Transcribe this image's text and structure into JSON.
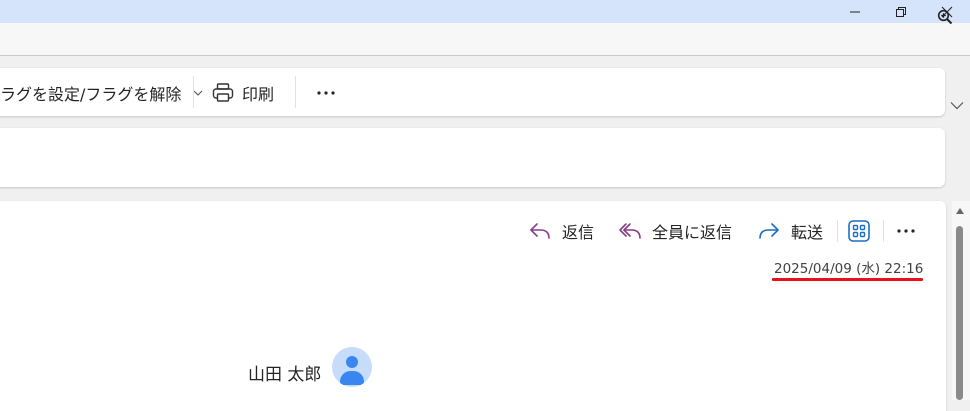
{
  "window": {
    "minimize_icon": "minimize-icon",
    "maximize_icon": "restore-icon",
    "close_icon": "close-icon"
  },
  "addressbar": {
    "zoom_icon": "zoom-in-icon"
  },
  "toolbar": {
    "flag_label": "ラグを設定/フラグを解除",
    "print_label": "印刷",
    "more_icon": "more-icon"
  },
  "actions": {
    "reply_label": "返信",
    "reply_all_label": "全員に返信",
    "forward_label": "転送",
    "apps_icon": "apps-icon",
    "more_icon": "more-icon"
  },
  "message": {
    "date": "2025/04/09 (水) 22:16",
    "sender_name": "山田 太郎"
  },
  "colors": {
    "titlebar": "#d6e4fb",
    "reply_icon": "#8a3c8a",
    "forward_icon": "#1a6fc4",
    "apps_icon": "#1a6fc4",
    "annotation_underline": "#e8101a",
    "avatar_bg": "#c7dcfb",
    "avatar_fg": "#3a86f0"
  }
}
